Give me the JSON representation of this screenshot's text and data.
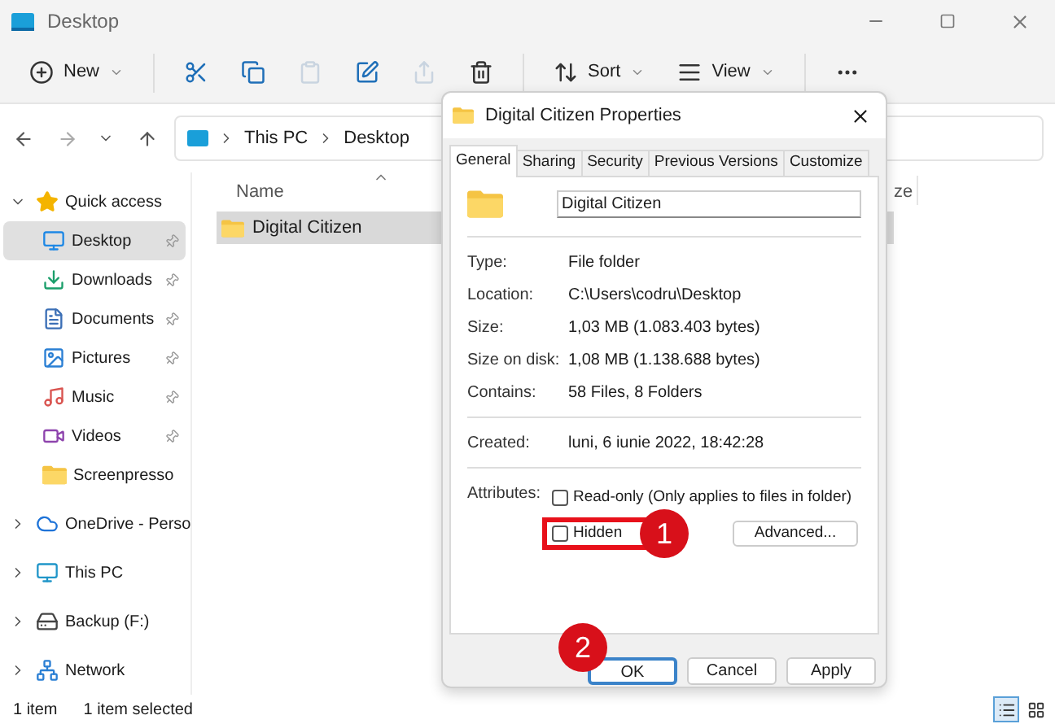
{
  "window": {
    "title": "Desktop"
  },
  "toolbar": [
    {
      "kind": "new",
      "label": "New",
      "disabled": false
    },
    {
      "kind": "cut",
      "disabled": false
    },
    {
      "kind": "copy",
      "disabled": false
    },
    {
      "kind": "paste",
      "disabled": true
    },
    {
      "kind": "rename",
      "disabled": false
    },
    {
      "kind": "share",
      "disabled": true
    },
    {
      "kind": "delete",
      "disabled": false
    },
    {
      "kind": "sort",
      "label": "Sort",
      "disabled": false
    },
    {
      "kind": "view",
      "label": "View",
      "disabled": false
    },
    {
      "kind": "more",
      "disabled": false
    }
  ],
  "breadcrumb": [
    "This PC",
    "Desktop"
  ],
  "sidebar": {
    "items": [
      {
        "label": "Quick access",
        "kind": "star",
        "expanded": true,
        "selected": false,
        "children": [
          {
            "label": "Desktop",
            "kind": "desktop",
            "pinned": true,
            "selected": true
          },
          {
            "label": "Downloads",
            "kind": "download",
            "pinned": true,
            "selected": false
          },
          {
            "label": "Documents",
            "kind": "documents",
            "pinned": true,
            "selected": false
          },
          {
            "label": "Pictures",
            "kind": "pictures",
            "pinned": true,
            "selected": false
          },
          {
            "label": "Music",
            "kind": "music",
            "pinned": true,
            "selected": false
          },
          {
            "label": "Videos",
            "kind": "videos",
            "pinned": true,
            "selected": false
          },
          {
            "label": "Screenpresso",
            "kind": "folder",
            "pinned": false,
            "selected": false
          }
        ]
      },
      {
        "label": "OneDrive - Perso",
        "kind": "cloud",
        "expanded": false,
        "selected": false
      },
      {
        "label": "This PC",
        "kind": "monitor",
        "expanded": false,
        "selected": false
      },
      {
        "label": "Backup (F:)",
        "kind": "drive",
        "expanded": false,
        "selected": false
      },
      {
        "label": "Network",
        "kind": "network",
        "expanded": false,
        "selected": false
      }
    ]
  },
  "table": {
    "columns": [
      "Name",
      "ze"
    ],
    "rows": [
      {
        "name": "Digital Citizen",
        "selected": true
      }
    ]
  },
  "status_bar": {
    "count": "1 item",
    "selection": "1 item selected"
  },
  "view_buttons": [
    {
      "kind": "details",
      "selected": true
    },
    {
      "kind": "tiles",
      "selected": false
    }
  ],
  "dialog": {
    "title": "Digital Citizen Properties",
    "tabs": [
      {
        "label": "General",
        "selected": true
      },
      {
        "label": "Sharing",
        "selected": false
      },
      {
        "label": "Security",
        "selected": false
      },
      {
        "label": "Previous Versions",
        "selected": false
      },
      {
        "label": "Customize",
        "selected": false
      }
    ],
    "name_value": "Digital Citizen",
    "groups": [
      [
        {
          "label": "Type:",
          "value": "File folder"
        },
        {
          "label": "Location:",
          "value": "C:\\Users\\codru\\Desktop"
        },
        {
          "label": "Size:",
          "value": "1,03 MB (1.083.403 bytes)"
        },
        {
          "label": "Size on disk:",
          "value": "1,08 MB (1.138.688 bytes)"
        },
        {
          "label": "Contains:",
          "value": "58 Files, 8 Folders"
        }
      ],
      [
        {
          "label": "Created:",
          "value": "luni, 6 iunie 2022, 18:42:28"
        }
      ]
    ],
    "attributes_label": "Attributes:",
    "attributes": [
      {
        "label": "Read-only (Only applies to files in folder)",
        "checked": false,
        "highlighted": false
      },
      {
        "label": "Hidden",
        "checked": false,
        "highlighted": true
      }
    ],
    "advanced_button": "Advanced...",
    "buttons": [
      {
        "label": "OK",
        "selected": true
      },
      {
        "label": "Cancel",
        "selected": false
      },
      {
        "label": "Apply",
        "selected": false
      }
    ]
  },
  "annotations": [
    {
      "label": "1"
    },
    {
      "label": "2"
    }
  ]
}
